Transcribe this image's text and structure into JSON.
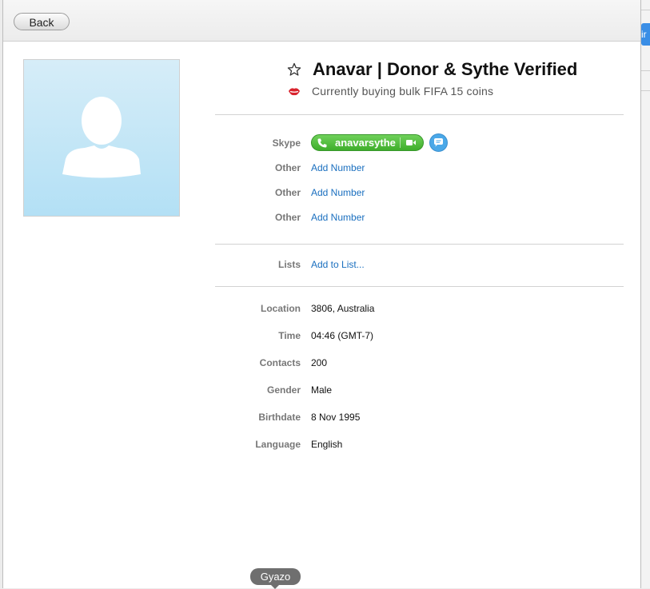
{
  "toolbar": {
    "back_label": "Back"
  },
  "right_edge": {
    "partial_text": "ir"
  },
  "profile": {
    "name": "Anavar | Donor & Sythe Verified",
    "mood": "Currently buying bulk FIFA 15 coins"
  },
  "contact": {
    "skype_label": "Skype",
    "skype_handle": "anavarsythe",
    "phones": [
      {
        "label": "Other",
        "action": "Add Number"
      },
      {
        "label": "Other",
        "action": "Add Number"
      },
      {
        "label": "Other",
        "action": "Add Number"
      }
    ]
  },
  "lists": {
    "label": "Lists",
    "action": "Add to List..."
  },
  "details": [
    {
      "label": "Location",
      "value": "3806, Australia"
    },
    {
      "label": "Time",
      "value": "04:46 (GMT-7)"
    },
    {
      "label": "Contacts",
      "value": "200"
    },
    {
      "label": "Gender",
      "value": "Male"
    },
    {
      "label": "Birthdate",
      "value": "8 Nov 1995"
    },
    {
      "label": "Language",
      "value": "English"
    }
  ],
  "overlay": {
    "gyazo_label": "Gyazo"
  },
  "icons": {
    "favorite": "star-outline-icon",
    "mood": "lips-icon",
    "call": "phone-icon",
    "video": "video-camera-icon",
    "chat": "chat-bubble-icon"
  },
  "colors": {
    "call_green": "#3fae2b",
    "link_blue": "#1a6fbf",
    "chat_blue": "#4aa8e8",
    "mood_red": "#d9232d",
    "avatar_blue": "#b3e0f5"
  }
}
